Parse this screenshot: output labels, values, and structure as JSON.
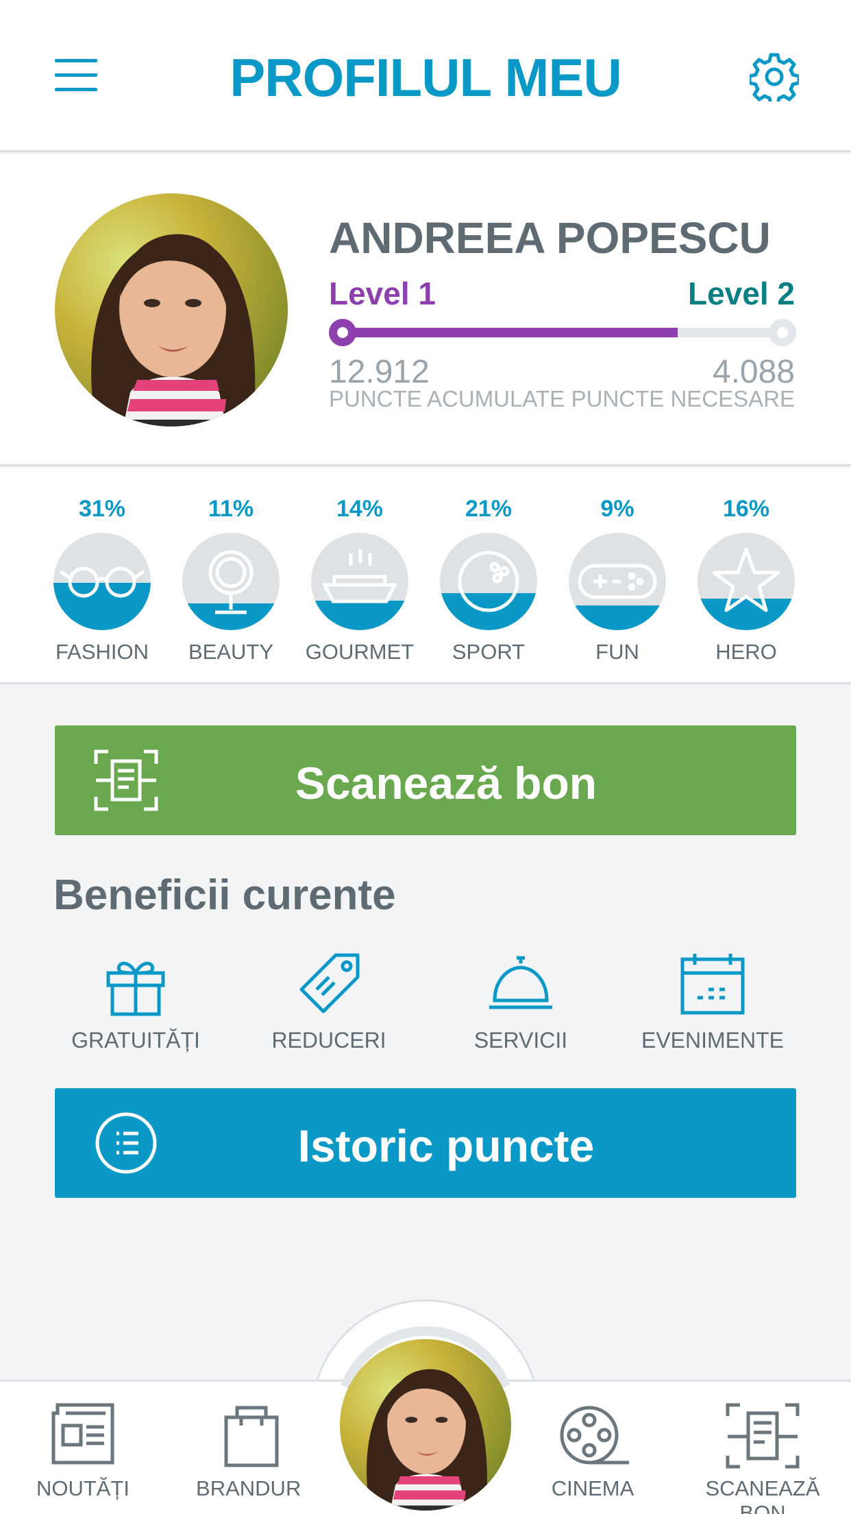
{
  "header": {
    "title": "PROFILUL MEU",
    "menu_icon": "menu-icon",
    "settings_icon": "gear-icon"
  },
  "profile": {
    "name": "ANDREEA POPESCU",
    "level_current": "Level 1",
    "level_next": "Level 2",
    "progress": 0.76,
    "points_accumulated": "12.912",
    "points_accumulated_label": "PUNCTE ACUMULATE",
    "points_needed": "4.088",
    "points_needed_label": "PUNCTE NECESARE"
  },
  "categories": [
    {
      "label": "FASHION",
      "percent": "31%",
      "fill": 0.31,
      "icon": "glasses-icon"
    },
    {
      "label": "BEAUTY",
      "percent": "11%",
      "fill": 0.11,
      "icon": "mirror-icon"
    },
    {
      "label": "GOURMET",
      "percent": "14%",
      "fill": 0.14,
      "icon": "dish-icon"
    },
    {
      "label": "SPORT",
      "percent": "21%",
      "fill": 0.21,
      "icon": "bowling-ball-icon"
    },
    {
      "label": "FUN",
      "percent": "9%",
      "fill": 0.09,
      "icon": "gamepad-icon"
    },
    {
      "label": "HERO",
      "percent": "16%",
      "fill": 0.16,
      "icon": "star-icon"
    }
  ],
  "scan_button": {
    "label": "Scanează bon",
    "icon": "scan-receipt-icon"
  },
  "benefits": {
    "title": "Beneficii curente",
    "items": [
      {
        "label": "GRATUITĂȚI",
        "icon": "gift-icon"
      },
      {
        "label": "REDUCERI",
        "icon": "tag-icon"
      },
      {
        "label": "SERVICII",
        "icon": "cloche-icon"
      },
      {
        "label": "EVENIMENTE",
        "icon": "calendar-icon"
      }
    ]
  },
  "history_button": {
    "label": "Istoric puncte",
    "icon": "list-icon"
  },
  "bottom_nav": {
    "items": [
      {
        "label": "NOUTĂȚI",
        "icon": "newspaper-icon"
      },
      {
        "label": "BRANDURI",
        "icon": "shopping-bag-icon"
      },
      {
        "label": "CINEMA",
        "icon": "film-reel-icon"
      },
      {
        "label": "SCANEAZĂ BON",
        "icon": "scan-receipt-icon"
      }
    ],
    "profile_progress": 0.35
  },
  "colors": {
    "accent_blue": "#0a98c6",
    "level_purple": "#8e3fae",
    "level_teal": "#0a7f83",
    "scan_green": "#69a84f",
    "text_gray": "#5f6b72"
  }
}
